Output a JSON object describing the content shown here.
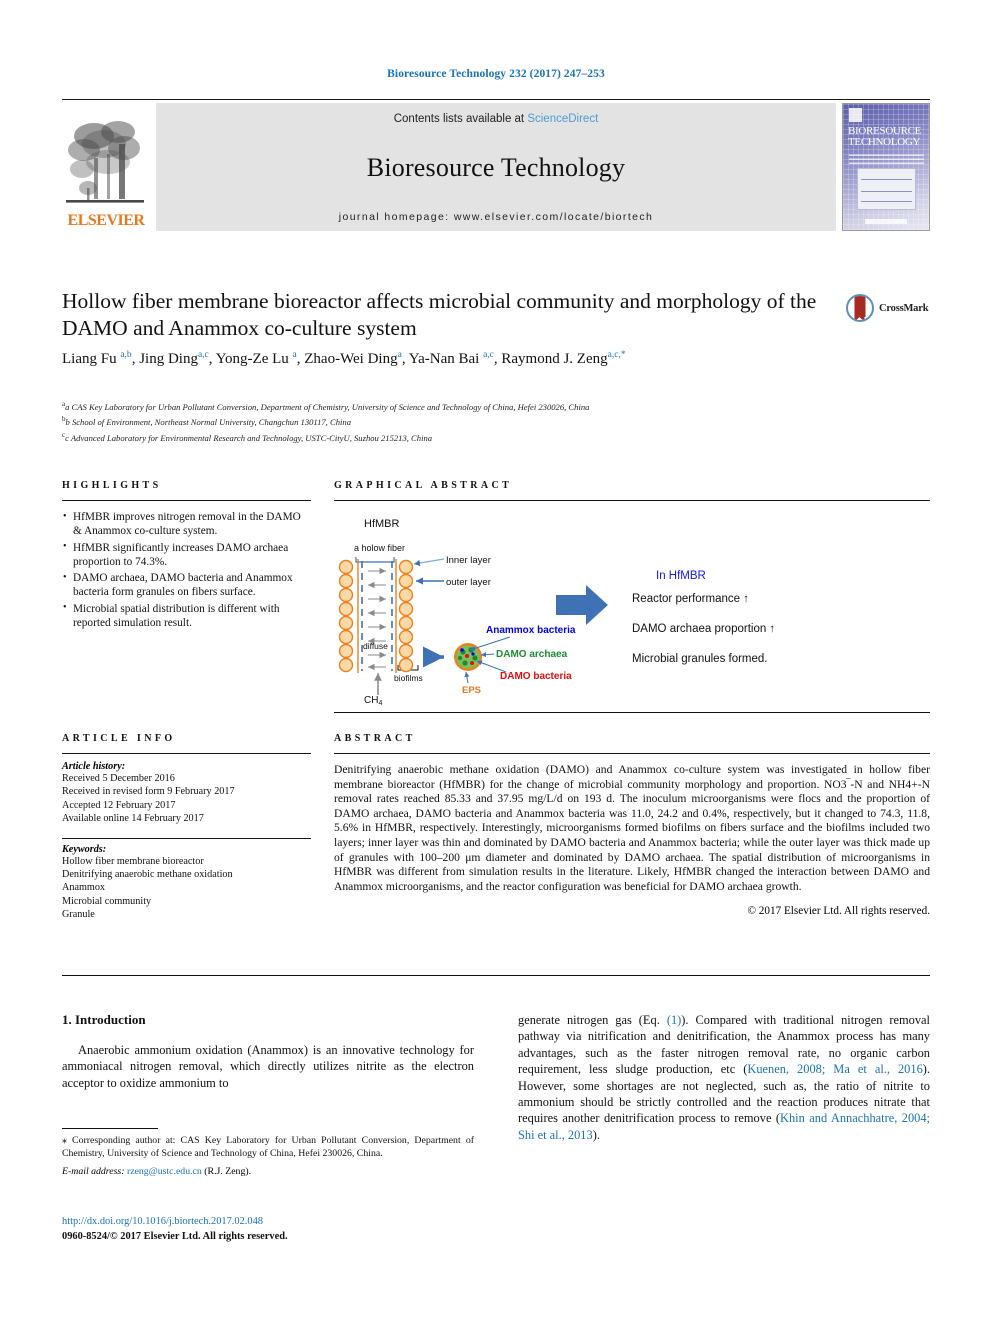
{
  "running_head": "Bioresource Technology 232 (2017) 247–253",
  "masthead": {
    "publisher": "ELSEVIER",
    "contents_prefix": "Contents lists available at ",
    "contents_link": "ScienceDirect",
    "journal_name": "Bioresource Technology",
    "homepage": "journal homepage: www.elsevier.com/locate/biortech",
    "cover_title_line1": "BIORESOURCE",
    "cover_title_line2": "TECHNOLOGY"
  },
  "article": {
    "title": "Hollow fiber membrane bioreactor affects microbial community and morphology of the DAMO and Anammox co-culture system",
    "crossmark_label": "CrossMark",
    "authors_html": "Liang Fu <sup>a,b</sup>, Jing Ding<sup>a,c</sup>, Yong-Ze Lu <sup>a</sup>, Zhao-Wei Ding<sup>a</sup>, Ya-Nan Bai <sup>a,c</sup>, Raymond J. Zeng<sup>a,c,*</sup>",
    "affiliations": [
      "a CAS Key Laboratory for Urban Pollutant Conversion, Department of Chemistry, University of Science and Technology of China, Hefei 230026, China",
      "b School of Environment, Northeast Normal University, Changchun 130117, China",
      "c Advanced Laboratory for Environmental Research and Technology, USTC-CityU, Suzhou 215213, China"
    ]
  },
  "highlights": {
    "heading": "HIGHLIGHTS",
    "items": [
      "HfMBR improves nitrogen removal in the DAMO & Anammox co-culture system.",
      "HfMBR significantly increases DAMO archaea proportion to 74.3%.",
      "DAMO archaea, DAMO bacteria and Anammox bacteria form granules on fibers surface.",
      "Microbial spatial distribution is different with reported simulation result."
    ]
  },
  "graphical_abstract": {
    "heading": "GRAPHICAL ABSTRACT",
    "reactor_label": "HfMBR",
    "fiber_label": "a holow fiber",
    "inner_layer_label": "Inner layer",
    "outer_layer_label": "outer layer",
    "diffuse_label": "diffuse",
    "biofilms_label": "biofilms",
    "ch4_label": "CH",
    "ch4_sub": "4",
    "granule_labels": {
      "anammox": "Anammox bacteria",
      "damo_archaea": "DAMO archaea",
      "damo_bacteria": "DAMO bacteria",
      "eps": "EPS"
    },
    "results_title": "In HfMBR",
    "results": [
      "Reactor performance ↑",
      "DAMO archaea proportion ↑",
      "Microbial granules formed."
    ],
    "colors": {
      "anammox": "#0000ee",
      "damo_archaea": "#1f8a32",
      "damo_bacteria": "#e01010",
      "eps": "#e87722",
      "arrow": "#3f72b5",
      "fiber_circle": "#fbd9a5",
      "fiber_stroke": "#e8821e"
    }
  },
  "article_info": {
    "heading": "ARTICLE INFO",
    "history_label": "Article history:",
    "history": [
      "Received 5 December 2016",
      "Received in revised form 9 February 2017",
      "Accepted 12 February 2017",
      "Available online 14 February 2017"
    ],
    "keywords_label": "Keywords:",
    "keywords": [
      "Hollow fiber membrane bioreactor",
      "Denitrifying anaerobic methane oxidation",
      "Anammox",
      "Microbial community",
      "Granule"
    ]
  },
  "abstract": {
    "heading": "ABSTRACT",
    "body": "Denitrifying anaerobic methane oxidation (DAMO) and Anammox co-culture system was investigated in hollow fiber membrane bioreactor (HfMBR) for the change of microbial community morphology and proportion. NO3‾-N and NH4+-N removal rates reached 85.33 and 37.95 mg/L/d on 193 d. The inoculum microorganisms were flocs and the proportion of DAMO archaea, DAMO bacteria and Anammox bacteria was 11.0, 24.2 and 0.4%, respectively, but it changed to 74.3, 11.8, 5.6% in HfMBR, respectively. Interestingly, microorganisms formed biofilms on fibers surface and the biofilms included two layers; inner layer was thin and dominated by DAMO bacteria and Anammox bacteria; while the outer layer was thick made up of granules with 100–200 μm diameter and dominated by DAMO archaea. The spatial distribution of microorganisms in HfMBR was different from simulation results in the literature. Likely, HfMBR changed the interaction between DAMO and Anammox microorganisms, and the reactor configuration was beneficial for DAMO archaea growth.",
    "rights": "© 2017 Elsevier Ltd. All rights reserved."
  },
  "introduction": {
    "heading": "1. Introduction",
    "paragraph_left": "Anaerobic ammonium oxidation (Anammox) is an innovative technology for ammoniacal nitrogen removal, which directly utilizes nitrite as the electron acceptor to oxidize ammonium to",
    "paragraph_right_parts": [
      "generate nitrogen gas (Eq. ",
      "(1)",
      "). Compared with traditional nitrogen removal pathway via nitrification and denitrification, the Anammox process has many advantages, such as the faster nitrogen removal rate, no organic carbon requirement, less sludge production, etc (",
      "Kuenen, 2008; Ma et al., 2016",
      "). However, some shortages are not neglected, such as, the ratio of nitrite to ammonium should be strictly controlled and the reaction produces nitrate that requires another denitrification process to remove (",
      "Khin and Annachhatre, 2004; Shi et al., 2013",
      ")."
    ]
  },
  "footnote": {
    "corresponding": "⁎ Corresponding author at: CAS Key Laboratory for Urban Pollutant Conversion, Department of Chemistry, University of Science and Technology of China, Hefei 230026, China.",
    "email_label": "E-mail address:",
    "email": "rzeng@ustc.edu.cn",
    "email_suffix": "(R.J. Zeng).",
    "doi": "http://dx.doi.org/10.1016/j.biortech.2017.02.048",
    "issn": "0960-8524/© 2017 Elsevier Ltd. All rights reserved."
  },
  "colors": {
    "link": "#1a72b8",
    "elsevier_orange": "#e87722",
    "band_grey": "#e3e3e3"
  }
}
